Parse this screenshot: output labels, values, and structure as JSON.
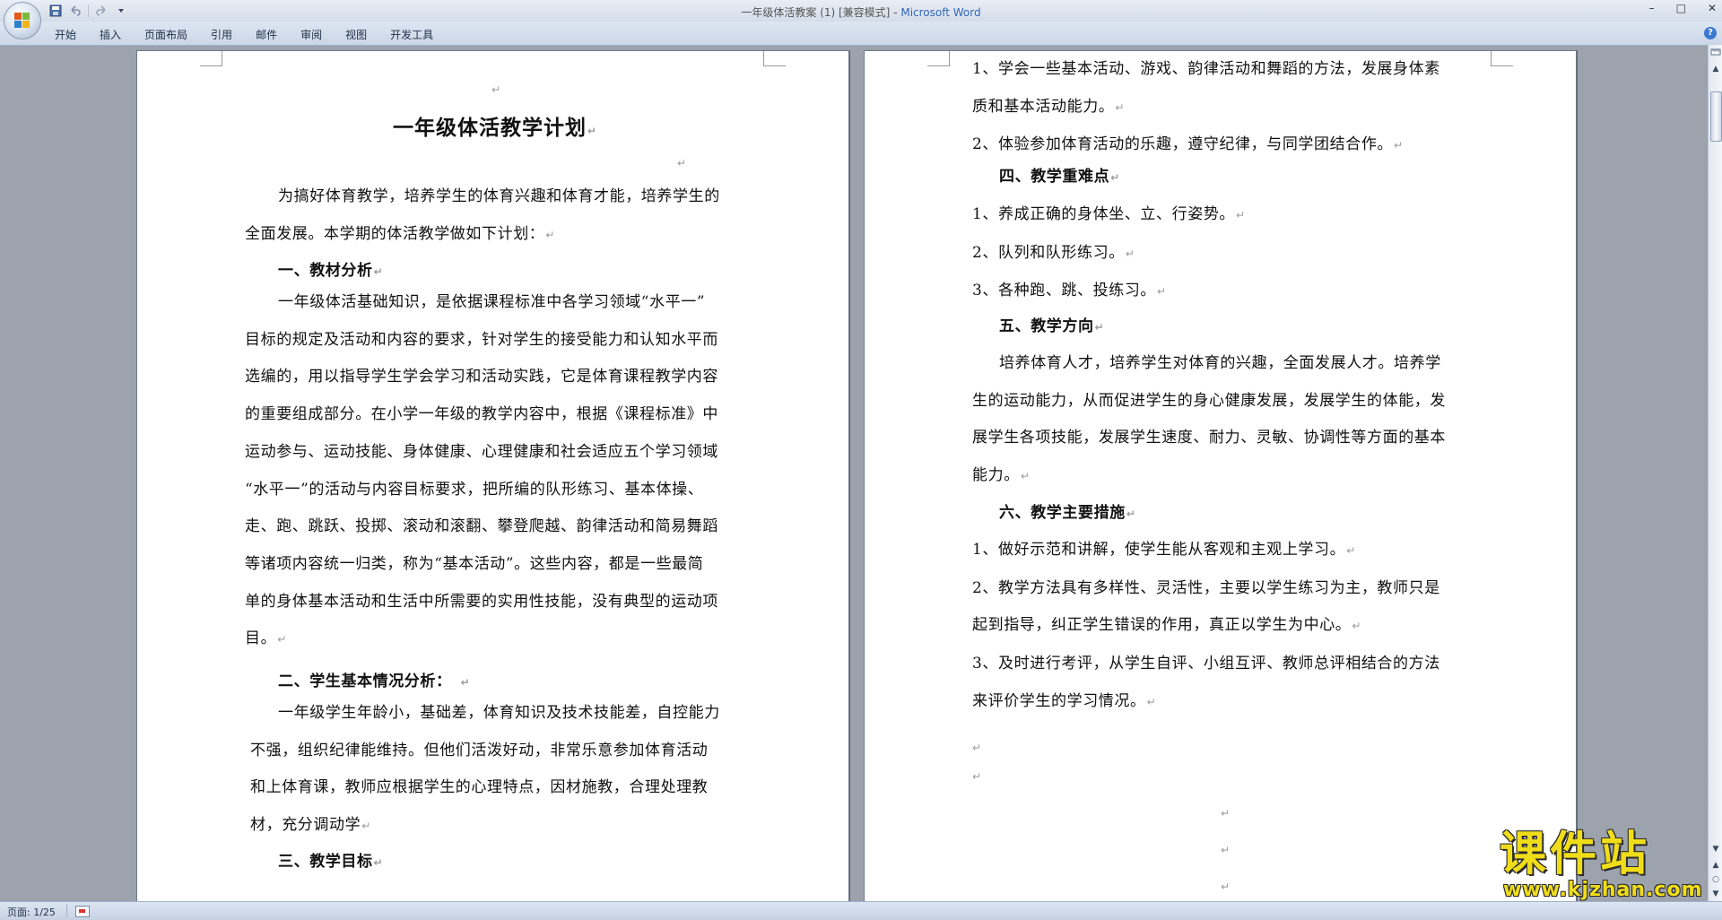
{
  "window": {
    "doc_name": "一年级体活教案 (1) [兼容模式]",
    "separator": " - ",
    "app_name": "Microsoft Word",
    "controls": {
      "minimize": "–",
      "maximize": "□",
      "close": "✕"
    }
  },
  "qat": {
    "save_icon": "save-icon",
    "undo_icon": "undo-icon",
    "redo_icon": "redo-icon",
    "customize_icon": "dropdown-arrow-icon"
  },
  "ribbon": {
    "tabs": [
      "开始",
      "插入",
      "页面布局",
      "引用",
      "邮件",
      "审阅",
      "视图",
      "开发工具"
    ],
    "help": "?"
  },
  "pilcrow": "↵",
  "left_page": {
    "title": "一年级体活教学计划",
    "intro": [
      "为搞好体育教学，培养学生的体育兴趣和体育才能，培养学生的",
      "全面发展。本学期的体活教学做如下计划："
    ],
    "h1": "一、教材分析",
    "p1": [
      "一年级体活基础知识，是依据课程标准中各学习领域“水平一”",
      "目标的规定及活动和内容的要求，针对学生的接受能力和认知水平而",
      "选编的，用以指导学生学会学习和活动实践，它是体育课程教学内容",
      "的重要组成部分。在小学一年级的教学内容中，根据《课程标准》中",
      "运动参与、运动技能、身体健康、心理健康和社会适应五个学习领域",
      "“水平一”的活动与内容目标要求，把所编的队形练习、基本体操、",
      "走、跑、跳跃、投掷、滚动和滚翻、攀登爬越、韵律活动和简易舞蹈",
      "等诸项内容统一归类，称为“基本活动”。这些内容，都是一些最简",
      "单的身体基本活动和生活中所需要的实用性技能，没有典型的运动项",
      "目。"
    ],
    "h2": "二、学生基本情况分析：",
    "p2": [
      "一年级学生年龄小，基础差，体育知识及技术技能差，自控能力",
      "不强，组织纪律能维持。但他们活泼好动，非常乐意参加体育活动",
      "和上体育课，教师应根据学生的心理特点，因材施教，合理处理教",
      "材，充分调动学"
    ],
    "h3": "三、教学目标"
  },
  "right_page": {
    "goals": [
      "1、学会一些基本活动、游戏、韵律活动和舞蹈的方法，发展身体素",
      "质和基本活动能力。",
      "2、体验参加体育活动的乐趣，遵守纪律，与同学团结合作。"
    ],
    "h4": "四、教学重难点",
    "points": [
      "1、养成正确的身体坐、立、行姿势。",
      "2、队列和队形练习。",
      "3、各种跑、跳、投练习。"
    ],
    "h5": "五、教学方向",
    "direction": [
      "培养体育人才，培养学生对体育的兴趣，全面发展人才。培养学",
      "生的运动能力，从而促进学生的身心健康发展，发展学生的体能，发",
      "展学生各项技能，发展学生速度、耐力、灵敏、协调性等方面的基本",
      "能力。"
    ],
    "h6": "六、教学主要措施",
    "measures": [
      "1、做好示范和讲解，使学生能从客观和主观上学习。",
      "2、教学方法具有多样性、灵活性，主要以学生练习为主，教师只是",
      "起到指导，纠正学生错误的作用，真正以学生为中心。",
      "3、及时进行考评，从学生自评、小组互评、教师总评相结合的方法",
      "来评价学生的学习情况。"
    ]
  },
  "status": {
    "page": "页面: 1/25"
  },
  "watermark": {
    "big": "课件站",
    "url": "www.kjzhan.com"
  },
  "scrollbar": {
    "up": "▲",
    "down": "▼",
    "prev_page": "▲",
    "select_browse": "○",
    "next_page": "▼"
  },
  "colors": {
    "app_title": "#3568b8",
    "watermark": "#f0dd1a",
    "background": "#9ca3ac"
  }
}
